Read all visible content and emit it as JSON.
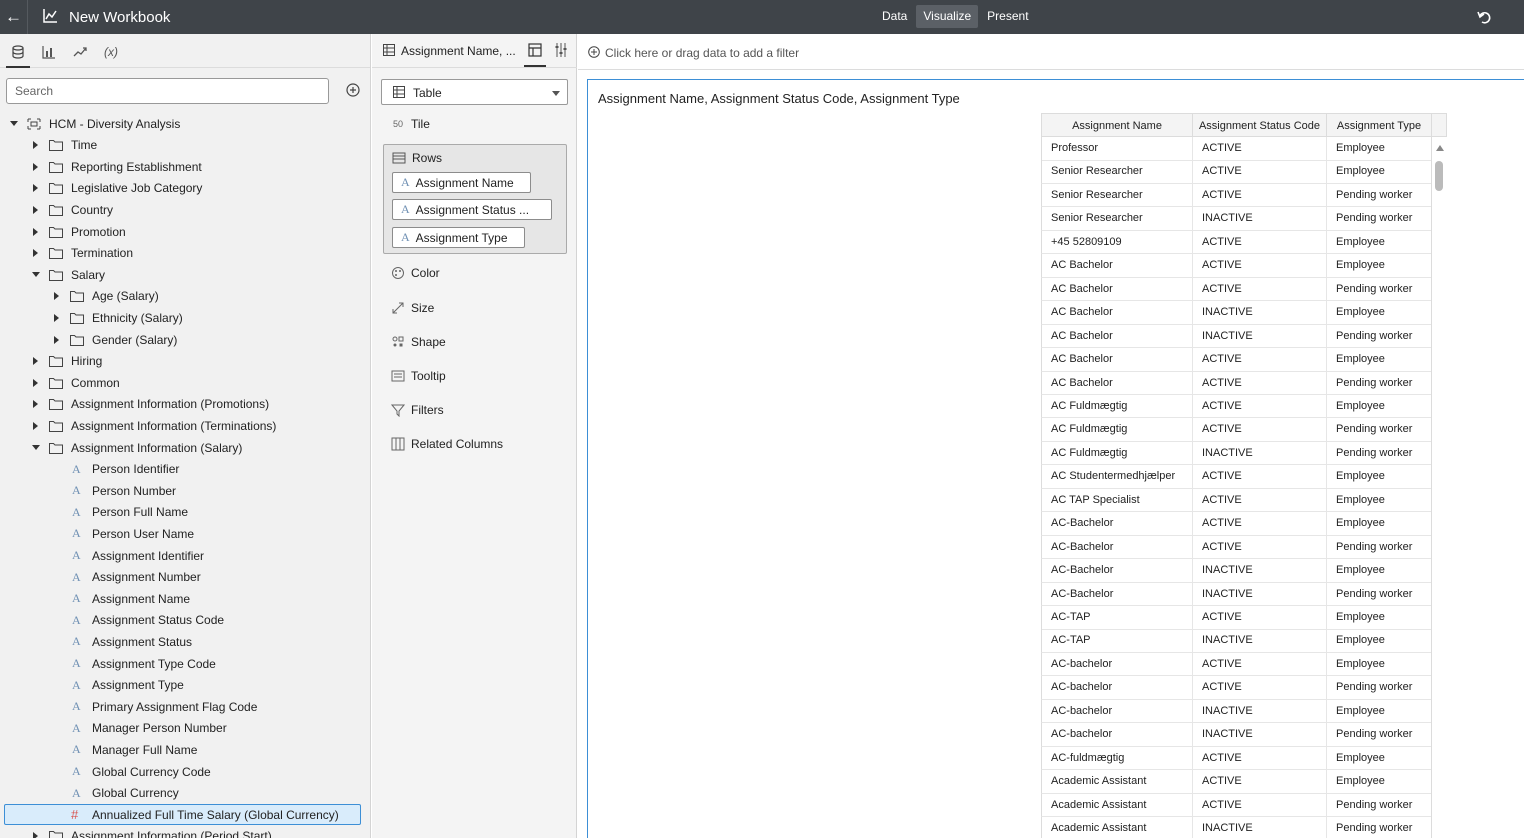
{
  "header": {
    "title": "New Workbook",
    "modes": [
      {
        "label": "Data",
        "active": false
      },
      {
        "label": "Visualize",
        "active": true
      },
      {
        "label": "Present",
        "active": false
      }
    ]
  },
  "data_panel": {
    "tabs": [
      "data-tab",
      "visualizations-tab",
      "analytics-tab",
      "(x)"
    ],
    "search_placeholder": "Search",
    "tree": [
      {
        "label": "HCM - Diversity Analysis",
        "kind": "subject",
        "level": 0,
        "expanded": true
      },
      {
        "label": "Time",
        "kind": "folder",
        "level": 1,
        "expanded": false
      },
      {
        "label": "Reporting Establishment",
        "kind": "folder",
        "level": 1,
        "expanded": false
      },
      {
        "label": "Legislative Job Category",
        "kind": "folder",
        "level": 1,
        "expanded": false
      },
      {
        "label": "Country",
        "kind": "folder",
        "level": 1,
        "expanded": false
      },
      {
        "label": "Promotion",
        "kind": "folder",
        "level": 1,
        "expanded": false
      },
      {
        "label": "Termination",
        "kind": "folder",
        "level": 1,
        "expanded": false
      },
      {
        "label": "Salary",
        "kind": "folder",
        "level": 1,
        "expanded": true
      },
      {
        "label": "Age (Salary)",
        "kind": "folder",
        "level": 2,
        "expanded": false
      },
      {
        "label": "Ethnicity (Salary)",
        "kind": "folder",
        "level": 2,
        "expanded": false
      },
      {
        "label": "Gender (Salary)",
        "kind": "folder",
        "level": 2,
        "expanded": false
      },
      {
        "label": "Hiring",
        "kind": "folder",
        "level": 1,
        "expanded": false
      },
      {
        "label": "Common",
        "kind": "folder",
        "level": 1,
        "expanded": false
      },
      {
        "label": "Assignment Information (Promotions)",
        "kind": "folder",
        "level": 1,
        "expanded": false
      },
      {
        "label": "Assignment Information (Terminations)",
        "kind": "folder",
        "level": 1,
        "expanded": false
      },
      {
        "label": "Assignment Information (Salary)",
        "kind": "folder",
        "level": 1,
        "expanded": true
      },
      {
        "label": "Person Identifier",
        "kind": "attr",
        "level": 2
      },
      {
        "label": "Person Number",
        "kind": "attr",
        "level": 2
      },
      {
        "label": "Person Full Name",
        "kind": "attr",
        "level": 2
      },
      {
        "label": "Person User Name",
        "kind": "attr",
        "level": 2
      },
      {
        "label": "Assignment Identifier",
        "kind": "attr",
        "level": 2
      },
      {
        "label": "Assignment Number",
        "kind": "attr",
        "level": 2
      },
      {
        "label": "Assignment Name",
        "kind": "attr",
        "level": 2
      },
      {
        "label": "Assignment Status Code",
        "kind": "attr",
        "level": 2
      },
      {
        "label": "Assignment Status",
        "kind": "attr",
        "level": 2
      },
      {
        "label": "Assignment Type Code",
        "kind": "attr",
        "level": 2
      },
      {
        "label": "Assignment Type",
        "kind": "attr",
        "level": 2
      },
      {
        "label": "Primary Assignment Flag Code",
        "kind": "attr",
        "level": 2
      },
      {
        "label": "Manager Person Number",
        "kind": "attr",
        "level": 2
      },
      {
        "label": "Manager Full Name",
        "kind": "attr",
        "level": 2
      },
      {
        "label": "Global Currency Code",
        "kind": "attr",
        "level": 2
      },
      {
        "label": "Global Currency",
        "kind": "attr",
        "level": 2
      },
      {
        "label": "Annualized Full Time Salary (Global Currency)",
        "kind": "measure",
        "level": 2,
        "selected": true
      },
      {
        "label": "Assignment Information (Period Start)",
        "kind": "folder",
        "level": 1,
        "expanded": false
      }
    ]
  },
  "grammar_panel": {
    "viz_name": "Assignment Name, ...",
    "viz_type": "Table",
    "tile_label": "Tile",
    "rows_label": "Rows",
    "rows_pills": [
      "Assignment Name",
      "Assignment Status ...",
      "Assignment Type"
    ],
    "sections": [
      "Color",
      "Size",
      "Shape",
      "Tooltip",
      "Filters",
      "Related Columns"
    ]
  },
  "canvas": {
    "filter_placeholder": "Click here or drag data to add a filter",
    "viz_title": "Assignment Name, Assignment Status Code, Assignment Type",
    "table": {
      "columns": [
        "Assignment Name",
        "Assignment Status Code",
        "Assignment Type"
      ],
      "rows": [
        [
          "Professor",
          "ACTIVE",
          "Employee"
        ],
        [
          "Senior Researcher",
          "ACTIVE",
          "Employee"
        ],
        [
          "Senior Researcher",
          "ACTIVE",
          "Pending worker"
        ],
        [
          "Senior Researcher",
          "INACTIVE",
          "Pending worker"
        ],
        [
          "+45 52809109",
          "ACTIVE",
          "Employee"
        ],
        [
          "AC Bachelor",
          "ACTIVE",
          "Employee"
        ],
        [
          "AC Bachelor",
          "ACTIVE",
          "Pending worker"
        ],
        [
          "AC Bachelor",
          "INACTIVE",
          "Employee"
        ],
        [
          "AC Bachelor",
          "INACTIVE",
          "Pending worker"
        ],
        [
          "AC Bachelor",
          "ACTIVE",
          "Employee"
        ],
        [
          "AC Bachelor",
          "ACTIVE",
          "Pending worker"
        ],
        [
          "AC Fuldmægtig",
          "ACTIVE",
          "Employee"
        ],
        [
          "AC Fuldmægtig",
          "ACTIVE",
          "Pending worker"
        ],
        [
          "AC Fuldmægtig",
          "INACTIVE",
          "Pending worker"
        ],
        [
          "AC Studentermedhjælper",
          "ACTIVE",
          "Employee"
        ],
        [
          "AC TAP Specialist",
          "ACTIVE",
          "Employee"
        ],
        [
          "AC-Bachelor",
          "ACTIVE",
          "Employee"
        ],
        [
          "AC-Bachelor",
          "ACTIVE",
          "Pending worker"
        ],
        [
          "AC-Bachelor",
          "INACTIVE",
          "Employee"
        ],
        [
          "AC-Bachelor",
          "INACTIVE",
          "Pending worker"
        ],
        [
          "AC-TAP",
          "ACTIVE",
          "Employee"
        ],
        [
          "AC-TAP",
          "INACTIVE",
          "Employee"
        ],
        [
          "AC-bachelor",
          "ACTIVE",
          "Employee"
        ],
        [
          "AC-bachelor",
          "ACTIVE",
          "Pending worker"
        ],
        [
          "AC-bachelor",
          "INACTIVE",
          "Employee"
        ],
        [
          "AC-bachelor",
          "INACTIVE",
          "Pending worker"
        ],
        [
          "AC-fuldmægtig",
          "ACTIVE",
          "Employee"
        ],
        [
          "Academic Assistant",
          "ACTIVE",
          "Employee"
        ],
        [
          "Academic Assistant",
          "ACTIVE",
          "Pending worker"
        ],
        [
          "Academic Assistant",
          "INACTIVE",
          "Pending worker"
        ]
      ]
    }
  },
  "colors": {
    "topbar": "#3f4449",
    "selection": "#3d8fd6",
    "attribute_icon": "#6e8fb3",
    "measure_icon": "#d9534f"
  }
}
